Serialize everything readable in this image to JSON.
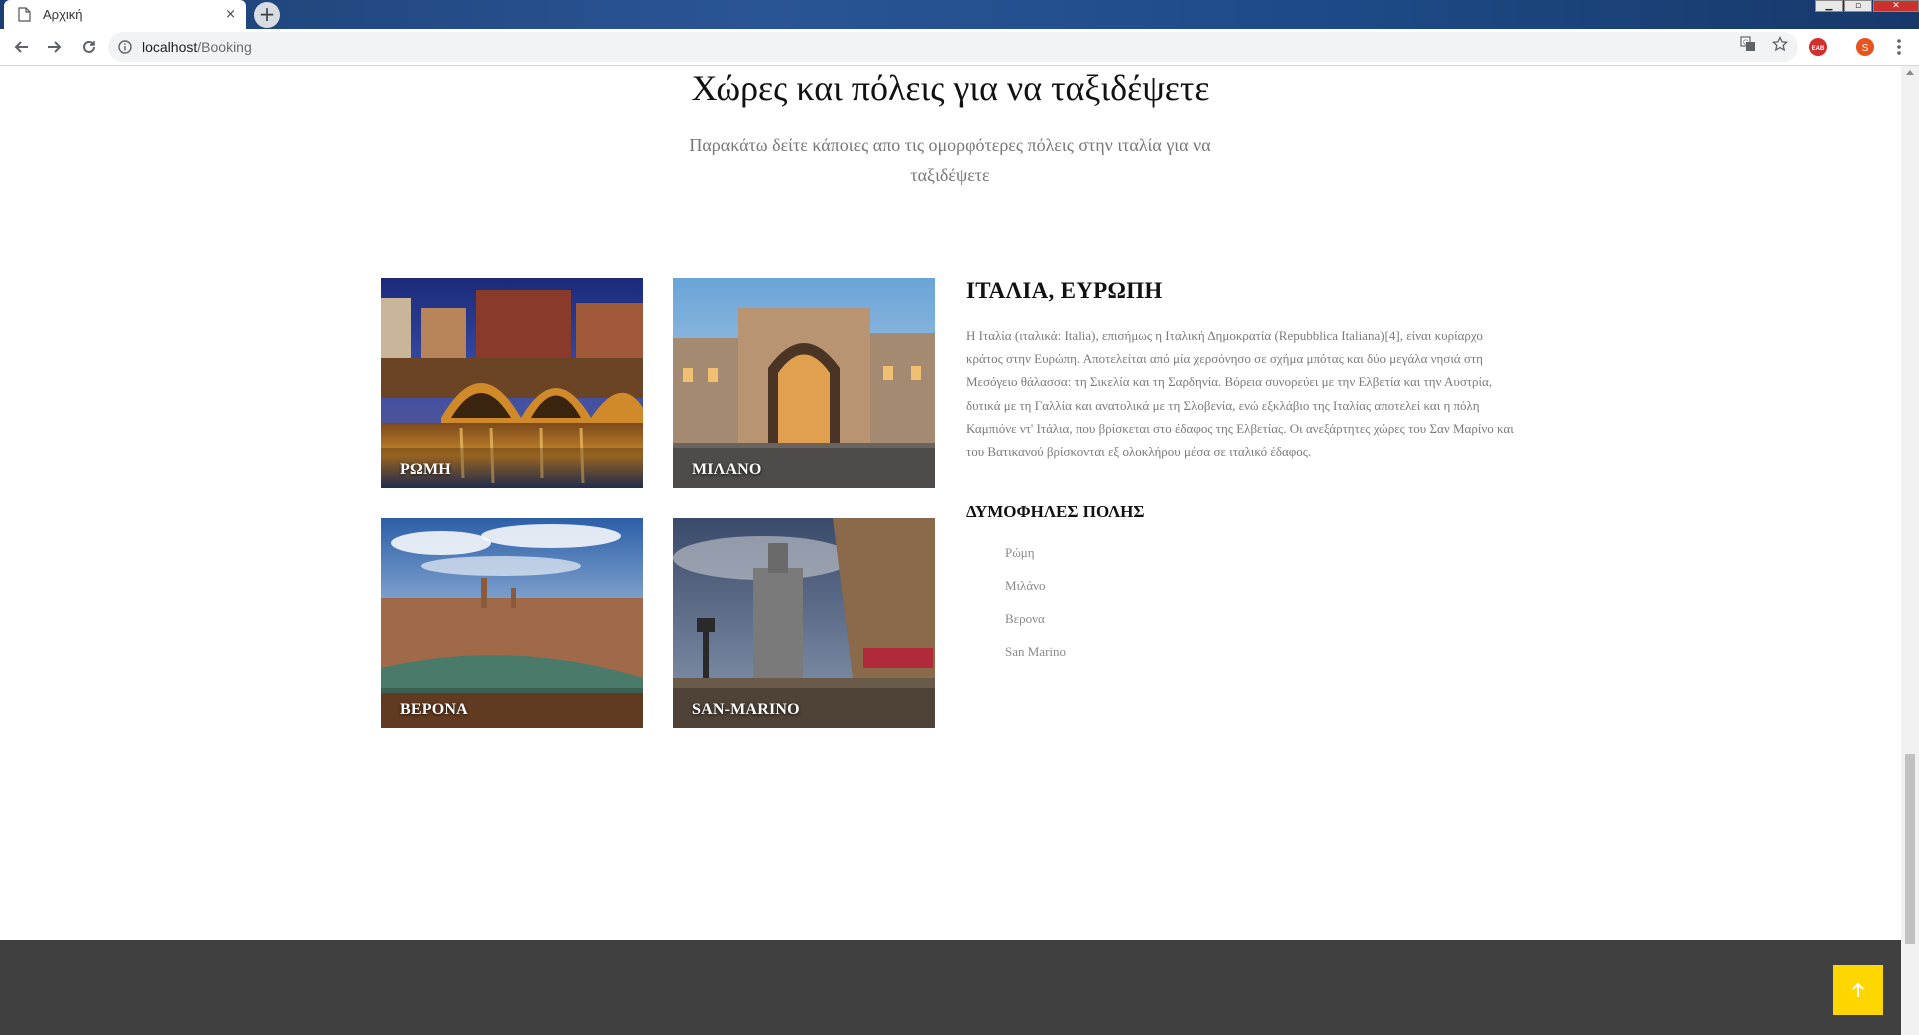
{
  "browser": {
    "tab_title": "Αρχική",
    "tab_close": "×",
    "new_tab": "+",
    "url_host": "localhost",
    "url_path": "/Booking",
    "extension_badge": "EAB",
    "profile_initial": "S"
  },
  "section": {
    "heading": "Χώρες και πόλεις για να ταξιδέψετε",
    "intro": "Παρακάτω δείτε κάποιες απο τις ομορφότερες πόλεις στην ιταλία για να ταξιδέψετε"
  },
  "cards": [
    {
      "label": "ΡΩΜΗ"
    },
    {
      "label": "ΜΙΛΑΝΟ"
    },
    {
      "label": "ΒΕΡΟΝΑ"
    },
    {
      "label": "SAN-MARINO"
    }
  ],
  "country": {
    "title": "ΙΤΑΛΙΑ, ΕΥΡΩΠΗ",
    "description": "Η Ιταλία (ιταλικά: Italia), επισήμως η Ιταλική Δημοκρατία (Repubblica Italiana)[4], είναι κυρίαρχο κράτος στην Ευρώπη. Αποτελείται από μία χερσόνησο σε σχήμα μπότας και δύο μεγάλα νησιά στη Μεσόγειο θάλασσα: τη Σικελία και τη Σαρδηνία. Βόρεια συνορεύει με την Ελβετία και την Αυστρία, δυτικά με τη Γαλλία και ανατολικά με τη Σλοβενία, ενώ εξκλάβιο της Ιταλίας αποτελεί και η πόλη Καμπιόνε ντ' Ιτάλια, που βρίσκεται στο έδαφος της Ελβετίας. Οι ανεξάρτητες χώρες του Σαν Μαρίνο και του Βατικανού βρίσκονται εξ ολοκλήρου μέσα σε ιταλικό έδαφος.",
    "popular_title": "ΔΥΜΟΦΗΛΕΣ ΠΟΛΗΣ",
    "popular_cities": [
      "Ρώμη",
      "Μιλάνο",
      "Βερονα",
      "San Marino"
    ]
  },
  "colors": {
    "footer": "#404040",
    "back_to_top": "#ffd600"
  },
  "icons": {
    "back_to_top": "arrow-up-icon"
  }
}
